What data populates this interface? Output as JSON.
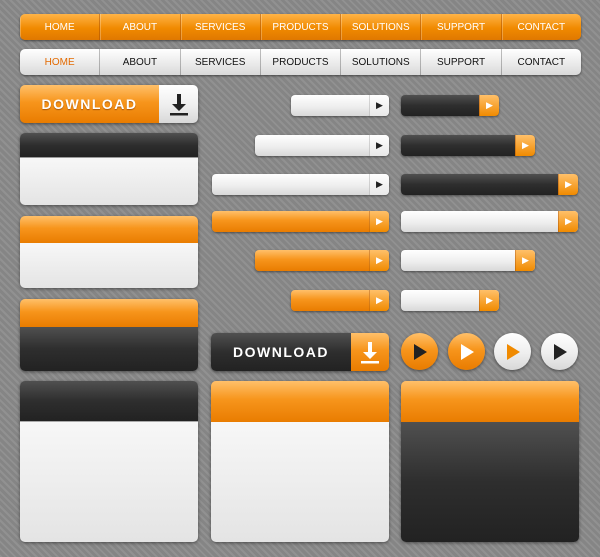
{
  "nav_orange": {
    "items": [
      "HOME",
      "ABOUT",
      "SERVICES",
      "PRODUCTS",
      "SOLUTIONS",
      "SUPPORT",
      "CONTACT"
    ]
  },
  "nav_white": {
    "items": [
      "HOME",
      "ABOUT",
      "SERVICES",
      "PRODUCTS",
      "SOLUTIONS",
      "SUPPORT",
      "CONTACT"
    ],
    "active_index": 0
  },
  "download_orange": {
    "label": "DOWNLOAD",
    "icon": "download-arrow-icon"
  },
  "download_dark": {
    "label": "DOWNLOAD",
    "icon": "download-arrow-icon"
  },
  "pill_arrow_icon": "triangle-right-icon",
  "circle_icons": [
    "play-icon",
    "play-icon",
    "play-icon",
    "play-icon"
  ],
  "colors": {
    "orange": "#f08a00",
    "dark": "#2e2e2e",
    "light": "#e8e8e8",
    "background": "#8a8a8a",
    "active_nav": "#e36a00"
  }
}
